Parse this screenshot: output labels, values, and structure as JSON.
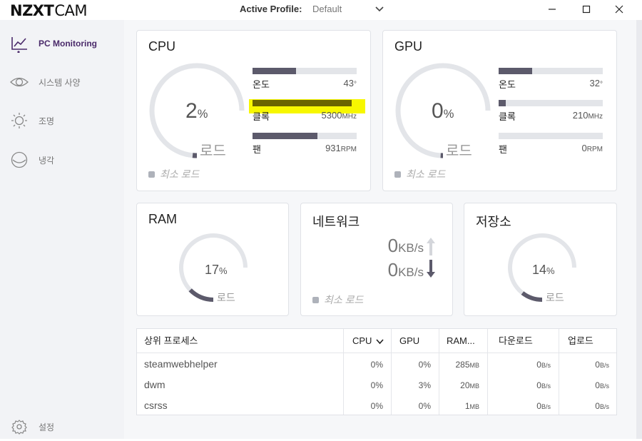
{
  "app": {
    "brand": "NZXT",
    "product": "CAM"
  },
  "profile": {
    "label": "Active Profile:",
    "value": "Default"
  },
  "sidebar": {
    "items": [
      {
        "label": "PC Monitoring",
        "icon": "chart-line-icon",
        "active": true
      },
      {
        "label": "시스템 사양",
        "icon": "eye-icon"
      },
      {
        "label": "조명",
        "icon": "sun-icon"
      },
      {
        "label": "냉각",
        "icon": "fan-icon"
      }
    ],
    "settings": {
      "label": "설정",
      "icon": "gear-icon"
    }
  },
  "cpu": {
    "title": "CPU",
    "load": {
      "value": "2",
      "unit": "%",
      "label": "로드",
      "fraction": 0.02
    },
    "min_load": "최소 로드",
    "metrics": [
      {
        "name": "온도",
        "value": "43",
        "unit": "°",
        "fill": 0.42
      },
      {
        "name": "클록",
        "value": "5300",
        "unit": "MHz",
        "fill": 0.95,
        "highlighted": true
      },
      {
        "name": "팬",
        "value": "931",
        "unit": "RPM",
        "fill": 0.62
      }
    ]
  },
  "gpu": {
    "title": "GPU",
    "load": {
      "value": "0",
      "unit": "%",
      "label": "로드",
      "fraction": 0.0
    },
    "min_load": "최소 로드",
    "metrics": [
      {
        "name": "온도",
        "value": "32",
        "unit": "°",
        "fill": 0.32
      },
      {
        "name": "클록",
        "value": "210",
        "unit": "MHz",
        "fill": 0.07
      },
      {
        "name": "팬",
        "value": "0",
        "unit": "RPM",
        "fill": 0.0
      }
    ]
  },
  "ram": {
    "title": "RAM",
    "load": {
      "value": "17",
      "unit": "%",
      "label": "로드",
      "fraction": 0.17
    }
  },
  "network": {
    "title": "네트워크",
    "upload": {
      "value": "0",
      "unit": "KB/s"
    },
    "download": {
      "value": "0",
      "unit": "KB/s"
    },
    "min_load": "최소 로드"
  },
  "storage": {
    "title": "저장소",
    "load": {
      "value": "14",
      "unit": "%",
      "label": "로드",
      "fraction": 0.14
    }
  },
  "processes": {
    "columns": [
      "상위 프로세스",
      "CPU",
      "GPU",
      "RAM...",
      "다운로드",
      "업로드"
    ],
    "rows": [
      {
        "name": "steamwebhelper",
        "cpu": "0%",
        "gpu": "0%",
        "ram": "285",
        "ram_unit": "MB",
        "down": "0",
        "down_unit": "B/s",
        "up": "0",
        "up_unit": "B/s"
      },
      {
        "name": "dwm",
        "cpu": "0%",
        "gpu": "3%",
        "ram": "20",
        "ram_unit": "MB",
        "down": "0",
        "down_unit": "B/s",
        "up": "0",
        "up_unit": "B/s"
      },
      {
        "name": "csrss",
        "cpu": "0%",
        "gpu": "0%",
        "ram": "1",
        "ram_unit": "MB",
        "down": "0",
        "down_unit": "B/s",
        "up": "0",
        "up_unit": "B/s"
      }
    ]
  },
  "colors": {
    "accent": "#4a2a6a",
    "bar_fill": "#5c5a6b",
    "gauge_track": "#e3e5e9",
    "highlight": "#f7f700"
  }
}
